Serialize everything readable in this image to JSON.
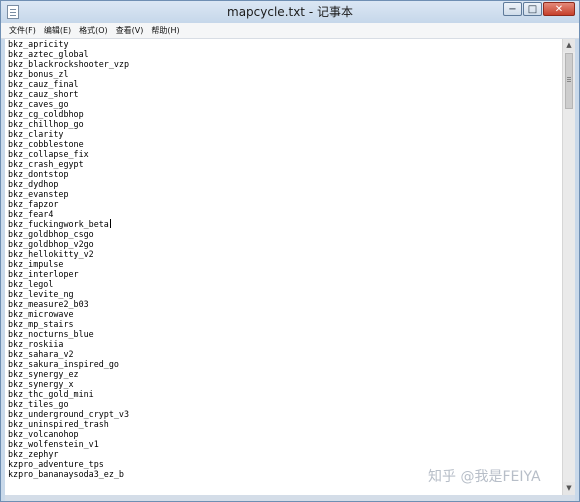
{
  "window": {
    "title": "mapcycle.txt - 记事本",
    "buttons": {
      "minimize": "−",
      "maximize": "□",
      "close": "✕"
    }
  },
  "menubar": {
    "items": [
      "文件(F)",
      "编辑(E)",
      "格式(O)",
      "查看(V)",
      "帮助(H)"
    ]
  },
  "editor": {
    "lines": [
      "bkz_apricity",
      "bkz_aztec_global",
      "bkz_blackrockshooter_vzp",
      "bkz_bonus_zl",
      "bkz_cauz_final",
      "bkz_cauz_short",
      "bkz_caves_go",
      "bkz_cg_coldbhop",
      "bkz_chillhop_go",
      "bkz_clarity",
      "bkz_cobblestone",
      "bkz_collapse_fix",
      "bkz_crash_egypt",
      "bkz_dontstop",
      "bkz_dydhop",
      "bkz_evanstep",
      "bkz_fapzor",
      "bkz_fear4",
      "bkz_fuckingwork_beta",
      "bkz_goldbhop_csgo",
      "bkz_goldbhop_v2go",
      "bkz_hellokitty_v2",
      "bkz_impulse",
      "bkz_interloper",
      "bkz_legol",
      "bkz_levite_ng",
      "bkz_measure2_b03",
      "bkz_microwave",
      "bkz_mp_stairs",
      "bkz_nocturns_blue",
      "bkz_roskiia",
      "bkz_sahara_v2",
      "bkz_sakura_inspired_go",
      "bkz_synergy_ez",
      "bkz_synergy_x",
      "bkz_thc_gold_mini",
      "bkz_tiles_go",
      "bkz_underground_crypt_v3",
      "bkz_uninspired_trash",
      "bkz_volcanohop",
      "bkz_wolfenstein_v1",
      "bkz_zephyr",
      "kzpro_adventure_tps",
      "kzpro_bananaysoda3_ez_b"
    ],
    "caret_line_index": 18
  },
  "scrollbar": {
    "up_arrow": "▲",
    "down_arrow": "▼"
  },
  "watermark": "知乎 @我是FEIYA"
}
